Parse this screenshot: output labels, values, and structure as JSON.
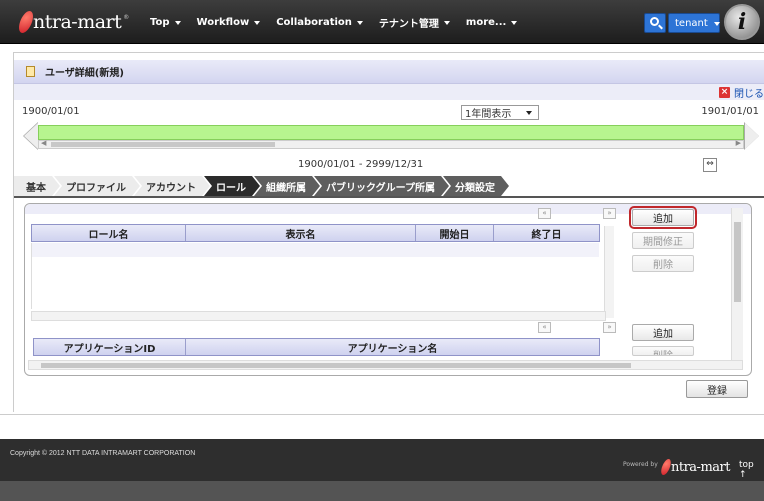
{
  "nav": {
    "logo_text": "ntra-mart",
    "logo_mark": "®",
    "items": [
      {
        "label": "Top"
      },
      {
        "label": "Workflow"
      },
      {
        "label": "Collaboration"
      },
      {
        "label": "テナント管理"
      },
      {
        "label": "more..."
      }
    ],
    "tenant_label": "tenant",
    "avatar_letter": "i"
  },
  "page": {
    "title": "ユーザ詳細(新規)",
    "close_label": "閉じる"
  },
  "timeline": {
    "start_date": "1900/01/01",
    "end_date": "1901/01/01",
    "period_select": "1年間表示",
    "range": "1900/01/01 - 2999/12/31"
  },
  "tabs": [
    {
      "label": "基本"
    },
    {
      "label": "プロファイル"
    },
    {
      "label": "アカウント"
    },
    {
      "label": "ロール"
    },
    {
      "label": "組織所属"
    },
    {
      "label": "パブリックグループ所属"
    },
    {
      "label": "分類設定"
    }
  ],
  "roles_table": {
    "headers": [
      "ロール名",
      "表示名",
      "開始日",
      "終了日"
    ],
    "add_label": "追加",
    "period_edit_label": "期間修正",
    "delete_label": "削除"
  },
  "apps_table": {
    "headers": [
      "アプリケーションID",
      "アプリケーション名"
    ],
    "add_label": "追加",
    "delete_label": "削除"
  },
  "register_label": "登録",
  "footer": {
    "copyright": "Copyright © 2012 NTT DATA INTRAMART CORPORATION",
    "powered_by": "Powered by",
    "logo_text": "ntra-mart",
    "top_link": "top ↑"
  }
}
